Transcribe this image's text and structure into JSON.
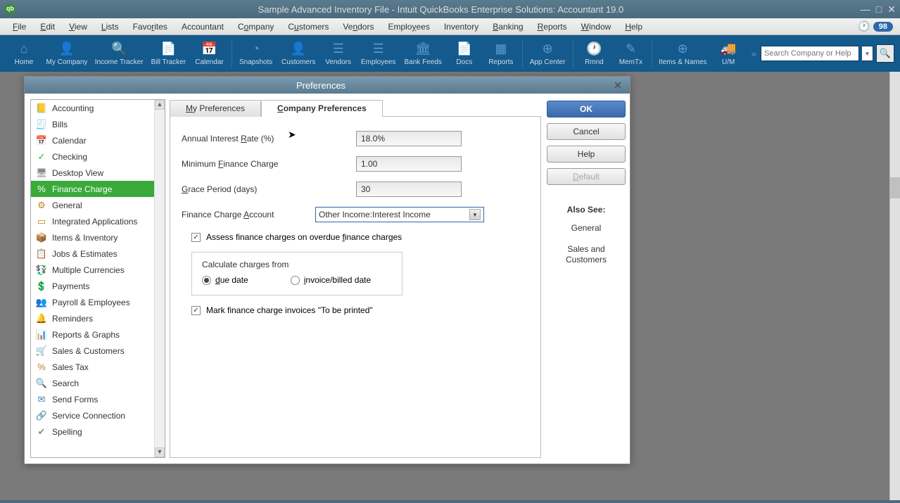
{
  "window": {
    "title": "Sample Advanced Inventory File  - Intuit QuickBooks Enterprise Solutions: Accountant 19.0",
    "badge": "98"
  },
  "menubar": [
    "File",
    "Edit",
    "View",
    "Lists",
    "Favorites",
    "Accountant",
    "Company",
    "Customers",
    "Vendors",
    "Employees",
    "Inventory",
    "Banking",
    "Reports",
    "Window",
    "Help"
  ],
  "toolbar": {
    "items": [
      {
        "label": "Home",
        "icon": "⌂"
      },
      {
        "label": "My Company",
        "icon": "👤"
      },
      {
        "label": "Income Tracker",
        "icon": "🔍"
      },
      {
        "label": "Bill Tracker",
        "icon": "📄"
      },
      {
        "label": "Calendar",
        "icon": "📅"
      },
      {
        "label": "Snapshots",
        "icon": "◔"
      },
      {
        "label": "Customers",
        "icon": "👤"
      },
      {
        "label": "Vendors",
        "icon": "☰"
      },
      {
        "label": "Employees",
        "icon": "☰"
      },
      {
        "label": "Bank Feeds",
        "icon": "🏛"
      },
      {
        "label": "Docs",
        "icon": "📄"
      },
      {
        "label": "Reports",
        "icon": "▦"
      },
      {
        "label": "App Center",
        "icon": "⊕"
      },
      {
        "label": "Rmnd",
        "icon": "🕐"
      },
      {
        "label": "MemTx",
        "icon": "✎"
      },
      {
        "label": "Items & Names",
        "icon": "⊕"
      },
      {
        "label": "U/M",
        "icon": "🚚"
      }
    ],
    "search_placeholder": "Search Company or Help"
  },
  "preferences": {
    "title": "Preferences",
    "categories": [
      {
        "label": "Accounting",
        "icon": "📒",
        "color": "#c08020"
      },
      {
        "label": "Bills",
        "icon": "🧾",
        "color": "#4080c0"
      },
      {
        "label": "Calendar",
        "icon": "📅",
        "color": "#4080c0"
      },
      {
        "label": "Checking",
        "icon": "✓",
        "color": "#3aaa3a"
      },
      {
        "label": "Desktop View",
        "icon": "🖥",
        "color": "#888"
      },
      {
        "label": "Finance Charge",
        "icon": "%",
        "color": "#8040a0",
        "selected": true
      },
      {
        "label": "General",
        "icon": "⚙",
        "color": "#c08020"
      },
      {
        "label": "Integrated Applications",
        "icon": "▭",
        "color": "#c08020"
      },
      {
        "label": "Items & Inventory",
        "icon": "📦",
        "color": "#c08020"
      },
      {
        "label": "Jobs & Estimates",
        "icon": "📋",
        "color": "#c08020"
      },
      {
        "label": "Multiple Currencies",
        "icon": "💱",
        "color": "#3aaa3a"
      },
      {
        "label": "Payments",
        "icon": "💲",
        "color": "#3aaa3a"
      },
      {
        "label": "Payroll & Employees",
        "icon": "👥",
        "color": "#c08020"
      },
      {
        "label": "Reminders",
        "icon": "🔔",
        "color": "#c08020"
      },
      {
        "label": "Reports & Graphs",
        "icon": "📊",
        "color": "#3aaa3a"
      },
      {
        "label": "Sales & Customers",
        "icon": "🛒",
        "color": "#c08020"
      },
      {
        "label": "Sales Tax",
        "icon": "%",
        "color": "#c08020"
      },
      {
        "label": "Search",
        "icon": "🔍",
        "color": "#888"
      },
      {
        "label": "Send Forms",
        "icon": "✉",
        "color": "#4080c0"
      },
      {
        "label": "Service Connection",
        "icon": "🔗",
        "color": "#4080c0"
      },
      {
        "label": "Spelling",
        "icon": "✔",
        "color": "#888"
      }
    ],
    "tabs": {
      "my": "My Preferences",
      "company": "Company Preferences"
    },
    "form": {
      "annual_rate_label": "Annual Interest Rate (%)",
      "annual_rate_value": "18.0%",
      "min_charge_label": "Minimum Finance Charge",
      "min_charge_value": "1.00",
      "grace_label": "Grace Period (days)",
      "grace_value": "30",
      "account_label": "Finance Charge Account",
      "account_value": "Other Income:Interest Income",
      "assess_label": "Assess finance charges on overdue finance charges",
      "assess_checked": true,
      "calc_title": "Calculate charges from",
      "calc_due": "due date",
      "calc_invoice": "invoice/billed date",
      "calc_selected": "due",
      "print_label": "Mark finance charge invoices \"To be printed\"",
      "print_checked": true
    },
    "buttons": {
      "ok": "OK",
      "cancel": "Cancel",
      "help": "Help",
      "default": "Default"
    },
    "also_see": {
      "title": "Also See:",
      "links": [
        "General",
        "Sales and Customers"
      ]
    }
  }
}
